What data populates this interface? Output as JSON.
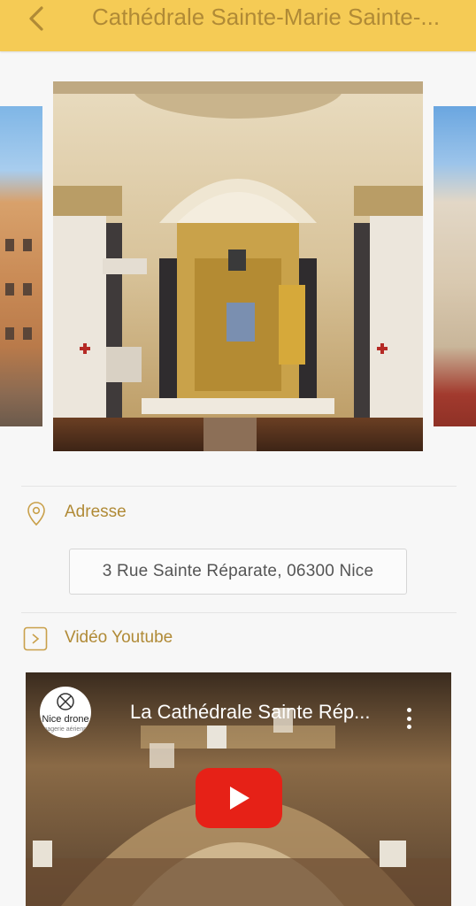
{
  "header": {
    "title": "Cathédrale Sainte-Marie Sainte-...",
    "back_icon": "chevron-left-icon",
    "background": "#f5cb55",
    "title_color": "#b08a36"
  },
  "carousel": {
    "slides": [
      "left-building",
      "cathedral-interior",
      "right-building"
    ]
  },
  "address": {
    "label": "Adresse",
    "icon": "location-pin-icon",
    "value": "3 Rue Sainte Réparate, 06300 Nice"
  },
  "video": {
    "label": "Vidéo Youtube",
    "icon": "play-square-icon",
    "title": "La Cathédrale Sainte Rép...",
    "channel": "Nice drone",
    "channel_sub": "imagerie aérienne",
    "play_color": "#e62117"
  }
}
